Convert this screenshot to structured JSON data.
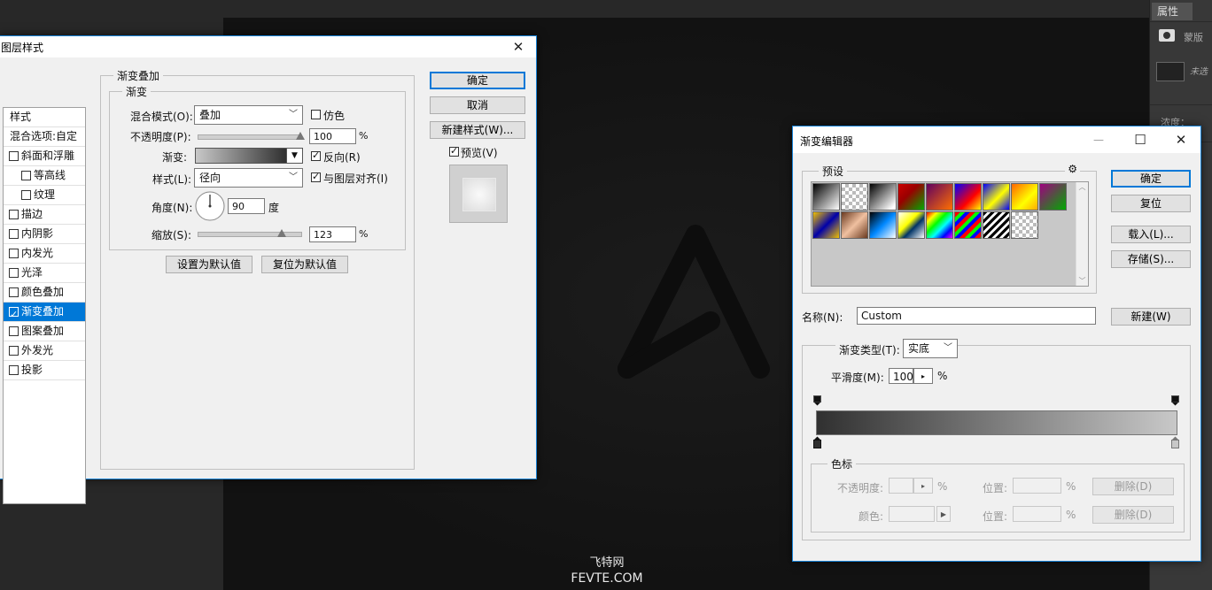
{
  "photoshop": {
    "properties_tab": "属性",
    "mask_label": "蒙版",
    "mask_status": "未选",
    "density_label": "浓度：",
    "watermark_cn": "飞特网",
    "watermark_en": "FEVTE.COM"
  },
  "layer_style": {
    "title": "图层样式",
    "close": "✕",
    "list_header": "样式",
    "blend_options": "混合选项:自定",
    "items": [
      {
        "label": "斜面和浮雕",
        "checked": false,
        "indent": false
      },
      {
        "label": "等高线",
        "checked": false,
        "indent": true
      },
      {
        "label": "纹理",
        "checked": false,
        "indent": true
      },
      {
        "label": "描边",
        "checked": false,
        "indent": false
      },
      {
        "label": "内阴影",
        "checked": false,
        "indent": false
      },
      {
        "label": "内发光",
        "checked": false,
        "indent": false
      },
      {
        "label": "光泽",
        "checked": false,
        "indent": false
      },
      {
        "label": "颜色叠加",
        "checked": false,
        "indent": false
      },
      {
        "label": "渐变叠加",
        "checked": true,
        "indent": false,
        "selected": true
      },
      {
        "label": "图案叠加",
        "checked": false,
        "indent": false
      },
      {
        "label": "外发光",
        "checked": false,
        "indent": false
      },
      {
        "label": "投影",
        "checked": false,
        "indent": false
      }
    ],
    "section_title": "渐变叠加",
    "subsection_title": "渐变",
    "blend_mode_label": "混合模式(O):",
    "blend_mode_value": "叠加",
    "dither_label": "仿色",
    "dither_checked": false,
    "opacity_label": "不透明度(P):",
    "opacity_value": "100",
    "opacity_fraction": 1.0,
    "percent": "%",
    "gradient_label": "渐变:",
    "reverse_label": "反向(R)",
    "reverse_checked": true,
    "style_label": "样式(L):",
    "style_value": "径向",
    "align_label": "与图层对齐(I)",
    "align_checked": true,
    "angle_label": "角度(N):",
    "angle_value": "90",
    "angle_unit": "度",
    "scale_label": "缩放(S):",
    "scale_value": "123",
    "scale_fraction": 0.82,
    "make_default": "设置为默认值",
    "reset_default": "复位为默认值",
    "ok": "确定",
    "cancel": "取消",
    "new_style": "新建样式(W)...",
    "preview_label": "预览(V)",
    "preview_checked": true
  },
  "gradient_editor": {
    "title": "渐变编辑器",
    "minimize": "—",
    "maximize": "☐",
    "close": "✕",
    "presets_label": "预设",
    "gear": "⚙",
    "ok": "确定",
    "reset": "复位",
    "load": "载入(L)...",
    "save": "存储(S)...",
    "name_label": "名称(N):",
    "name_value": "Custom",
    "new_button": "新建(W)",
    "type_label": "渐变类型(T):",
    "type_value": "实底",
    "smooth_label": "平滑度(M):",
    "smooth_value": "100",
    "smooth_unit": "%",
    "stops_group": "色标",
    "opacity_label": "不透明度:",
    "opacity_unit": "%",
    "position_label": "位置:",
    "position_unit": "%",
    "delete_label": "删除(D)",
    "color_label": "颜色:",
    "gradient_start": "#303030",
    "gradient_end": "#c8c8c8"
  }
}
